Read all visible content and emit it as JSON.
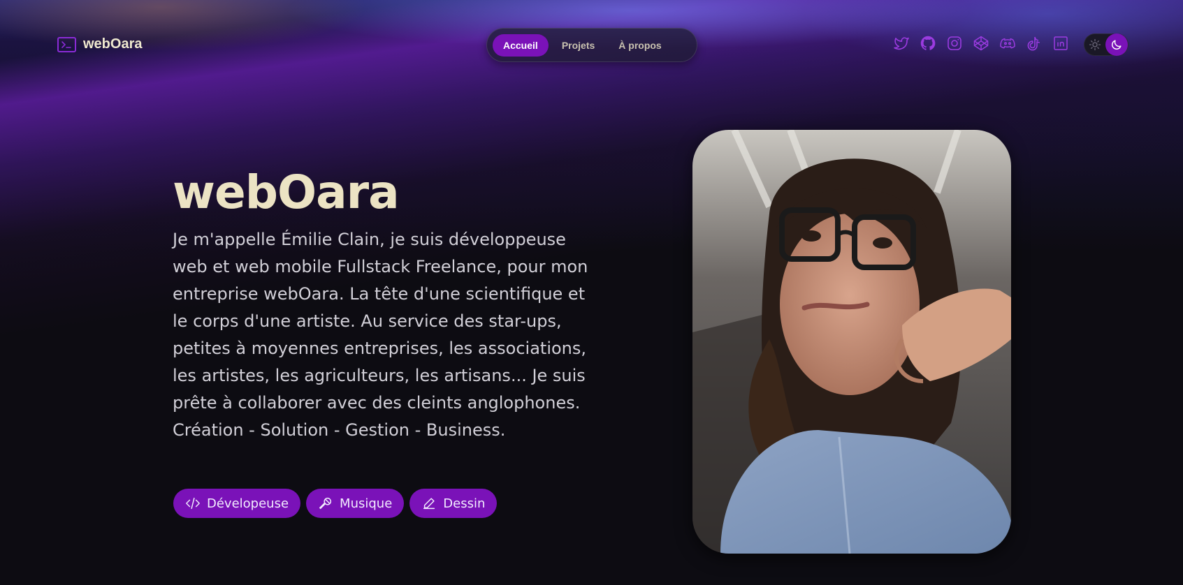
{
  "brand": {
    "name": "webOara",
    "icon": "terminal-icon"
  },
  "nav": {
    "items": [
      {
        "label": "Accueil",
        "active": true
      },
      {
        "label": "Projets",
        "active": false
      },
      {
        "label": "À propos",
        "active": false
      }
    ]
  },
  "socials": [
    "twitter-icon",
    "github-icon",
    "instagram-icon",
    "codepen-icon",
    "discord-icon",
    "tiktok-icon",
    "linkedin-icon"
  ],
  "theme_toggle": {
    "mode": "dark",
    "icons": [
      "sun-icon",
      "moon-icon"
    ]
  },
  "hero": {
    "title": "webOara",
    "description": "Je m'appelle Émilie Clain, je suis développeuse web et web mobile Fullstack Freelance, pour mon entreprise webOara. La tête d'une scientifique et le corps d'une artiste. Au service des star-ups, petites à moyennes entreprises, les associations, les artistes, les agriculteurs, les artisans... Je suis prête à collaborer avec des cleints anglophones. Création - Solution - Gestion - Business.",
    "tags": [
      {
        "label": "Dévelopeuse",
        "icon": "code-icon"
      },
      {
        "label": "Musique",
        "icon": "microphone-icon"
      },
      {
        "label": "Dessin",
        "icon": "pencil-icon"
      }
    ]
  },
  "colors": {
    "accent": "#7a12b8",
    "icon": "#9b3be0",
    "title": "#ece3c4",
    "text": "#d2d0d8",
    "background": "#0d0c12"
  }
}
